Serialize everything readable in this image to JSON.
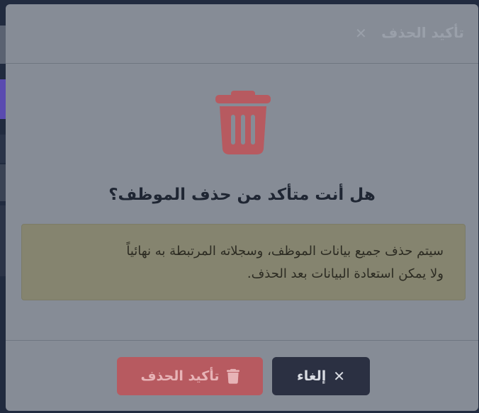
{
  "modal": {
    "title": "تأكيد الحذف",
    "close_icon": "close-icon",
    "big_icon": "trash-icon",
    "question": "هل أنت متأكد من حذف الموظف؟",
    "warning_line1": "سيتم حذف جميع بيانات الموظف، وسجلاته المرتبطة به نهائياً",
    "warning_line2": "ولا يمكن استعادة البيانات بعد الحذف.",
    "buttons": {
      "cancel_label": "إلغاء",
      "cancel_icon": "close-icon",
      "confirm_label": "تأكيد الحذف",
      "confirm_icon": "trash-icon"
    }
  },
  "colors": {
    "danger": "#b75a60",
    "dark": "#2b3042",
    "warning_bg": "#85846f"
  }
}
